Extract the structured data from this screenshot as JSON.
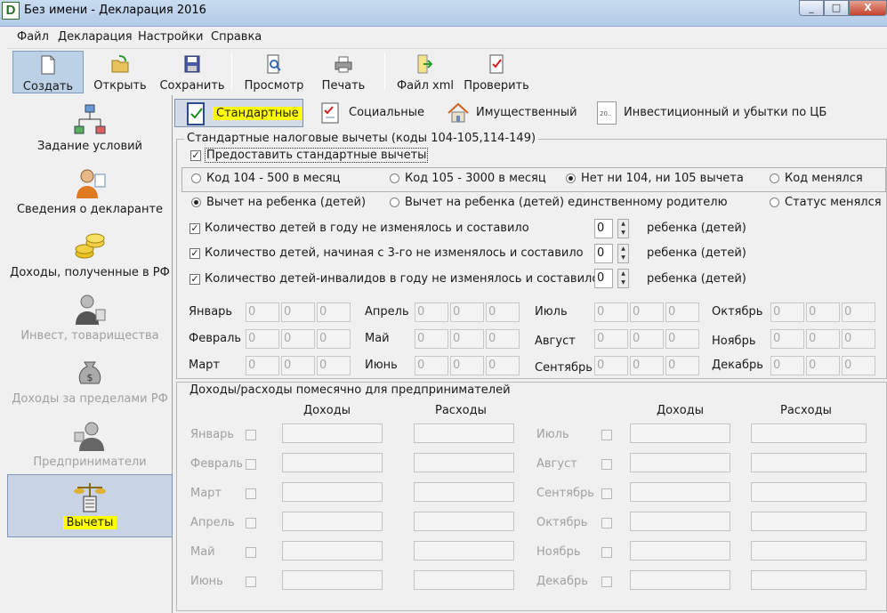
{
  "window": {
    "title": "Без имени - Декларация 2016",
    "icon_letter": "D",
    "min": "_",
    "max": "□",
    "close": "X"
  },
  "menu": [
    "Файл",
    "Декларация",
    "Настройки",
    "Справка"
  ],
  "toolbar": {
    "create": "Создать",
    "open": "Открыть",
    "save": "Сохранить",
    "preview": "Просмотр",
    "print": "Печать",
    "xml": "Файл xml",
    "check": "Проверить"
  },
  "nav": [
    "Задание условий",
    "Сведения о декларанте",
    "Доходы, полученные в РФ",
    "Инвест, товарищества",
    "Доходы за пределами РФ",
    "Предприниматели",
    "Вычеты"
  ],
  "tabs": [
    "Стандартные",
    "Социальные",
    "Имущественный",
    "Инвестиционный и убытки по ЦБ"
  ],
  "tab_icon_text": "20..",
  "standard": {
    "group_title": "Стандартные налоговые вычеты (коды 104-105,114-149)",
    "provide_label": "Предоставить стандартные вычеты",
    "provide_checked": "✓",
    "r_104": "Код 104 - 500 в месяц",
    "r_105": "Код 105 - 3000 в месяц",
    "r_none": "Нет ни 104, ни 105 вычета",
    "r_code_changed": "Код менялся",
    "r_child": "Вычет на ребенка (детей)",
    "r_single": "Вычет на ребенка (детей) единственному родителю",
    "r_status": "Статус менялся",
    "count_rows": [
      {
        "label": "Количество детей в году не изменялось и составило",
        "value": "0",
        "unit": "ребенка (детей)",
        "check": "✓"
      },
      {
        "label": "Количество детей, начиная с 3-го не изменялось и составило",
        "value": "0",
        "unit": "ребенка (детей)",
        "check": "✓"
      },
      {
        "label": "Количество детей-инвалидов в году не изменялось и составило",
        "value": "0",
        "unit": "ребенка (детей)",
        "check": "✓"
      }
    ],
    "months": [
      "Январь",
      "Февраль",
      "Март",
      "Апрель",
      "Май",
      "Июнь",
      "Июль",
      "Август",
      "Сентябрь",
      "Октябрь",
      "Ноябрь",
      "Декабрь"
    ],
    "month_value": "0"
  },
  "entrepreneur": {
    "group_title": "Доходы/расходы помесячно для предпринимателей",
    "income": "Доходы",
    "expense": "Расходы",
    "months": [
      "Январь",
      "Февраль",
      "Март",
      "Апрель",
      "Май",
      "Июнь",
      "Июль",
      "Август",
      "Сентябрь",
      "Октябрь",
      "Ноябрь",
      "Декабрь"
    ]
  }
}
